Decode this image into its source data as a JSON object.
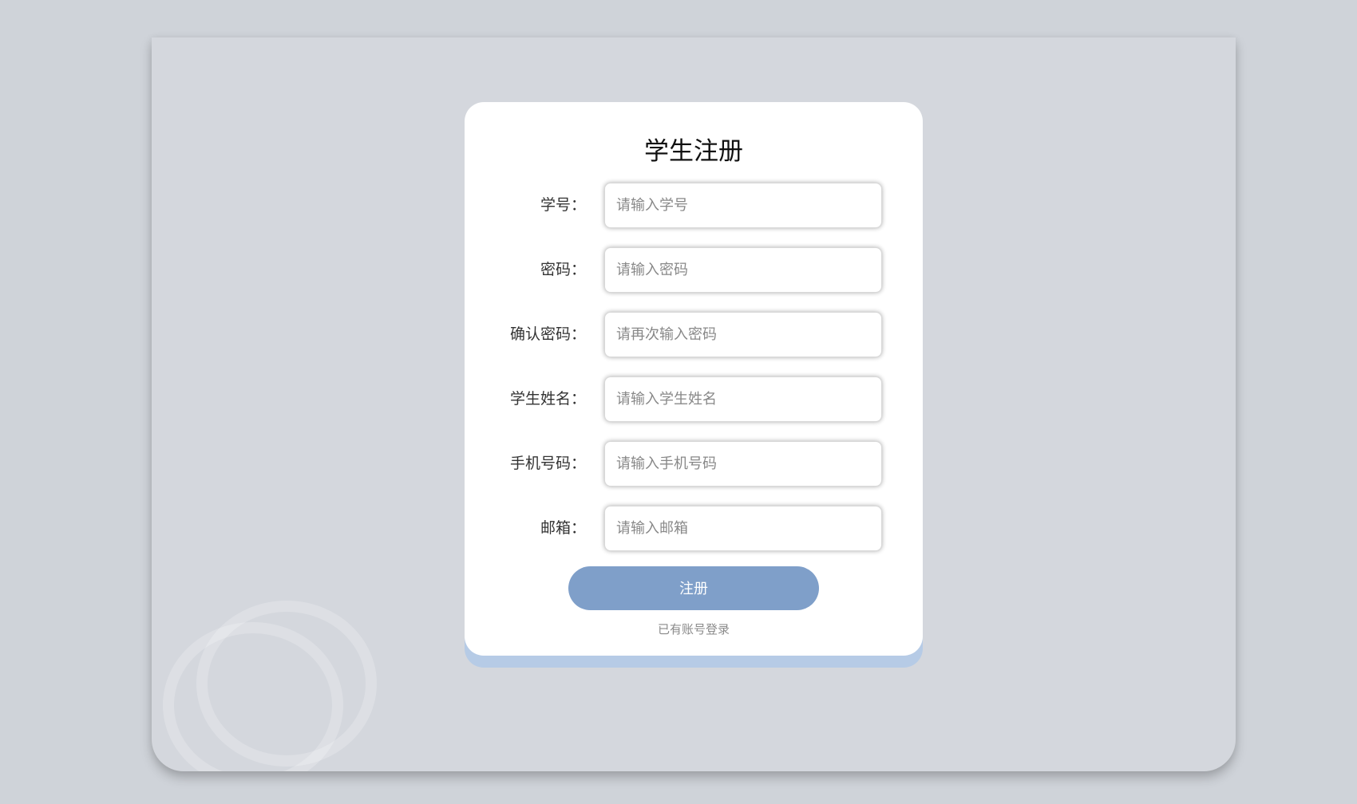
{
  "register": {
    "title": "学生注册",
    "fields": [
      {
        "label": "学号：",
        "placeholder": "请输入学号",
        "value": ""
      },
      {
        "label": "密码：",
        "placeholder": "请输入密码",
        "value": ""
      },
      {
        "label": "确认密码：",
        "placeholder": "请再次输入密码",
        "value": ""
      },
      {
        "label": "学生姓名：",
        "placeholder": "请输入学生姓名",
        "value": ""
      },
      {
        "label": "手机号码：",
        "placeholder": "请输入手机号码",
        "value": ""
      },
      {
        "label": "邮箱：",
        "placeholder": "请输入邮箱",
        "value": ""
      }
    ],
    "submit_label": "注册",
    "login_link": "已有账号登录"
  },
  "colors": {
    "page_background": "#cfd3d9",
    "panel_background": "#d4d7dd",
    "card_background": "#ffffff",
    "card_accent": "#b6cbe6",
    "button": "#7f9fc9"
  }
}
